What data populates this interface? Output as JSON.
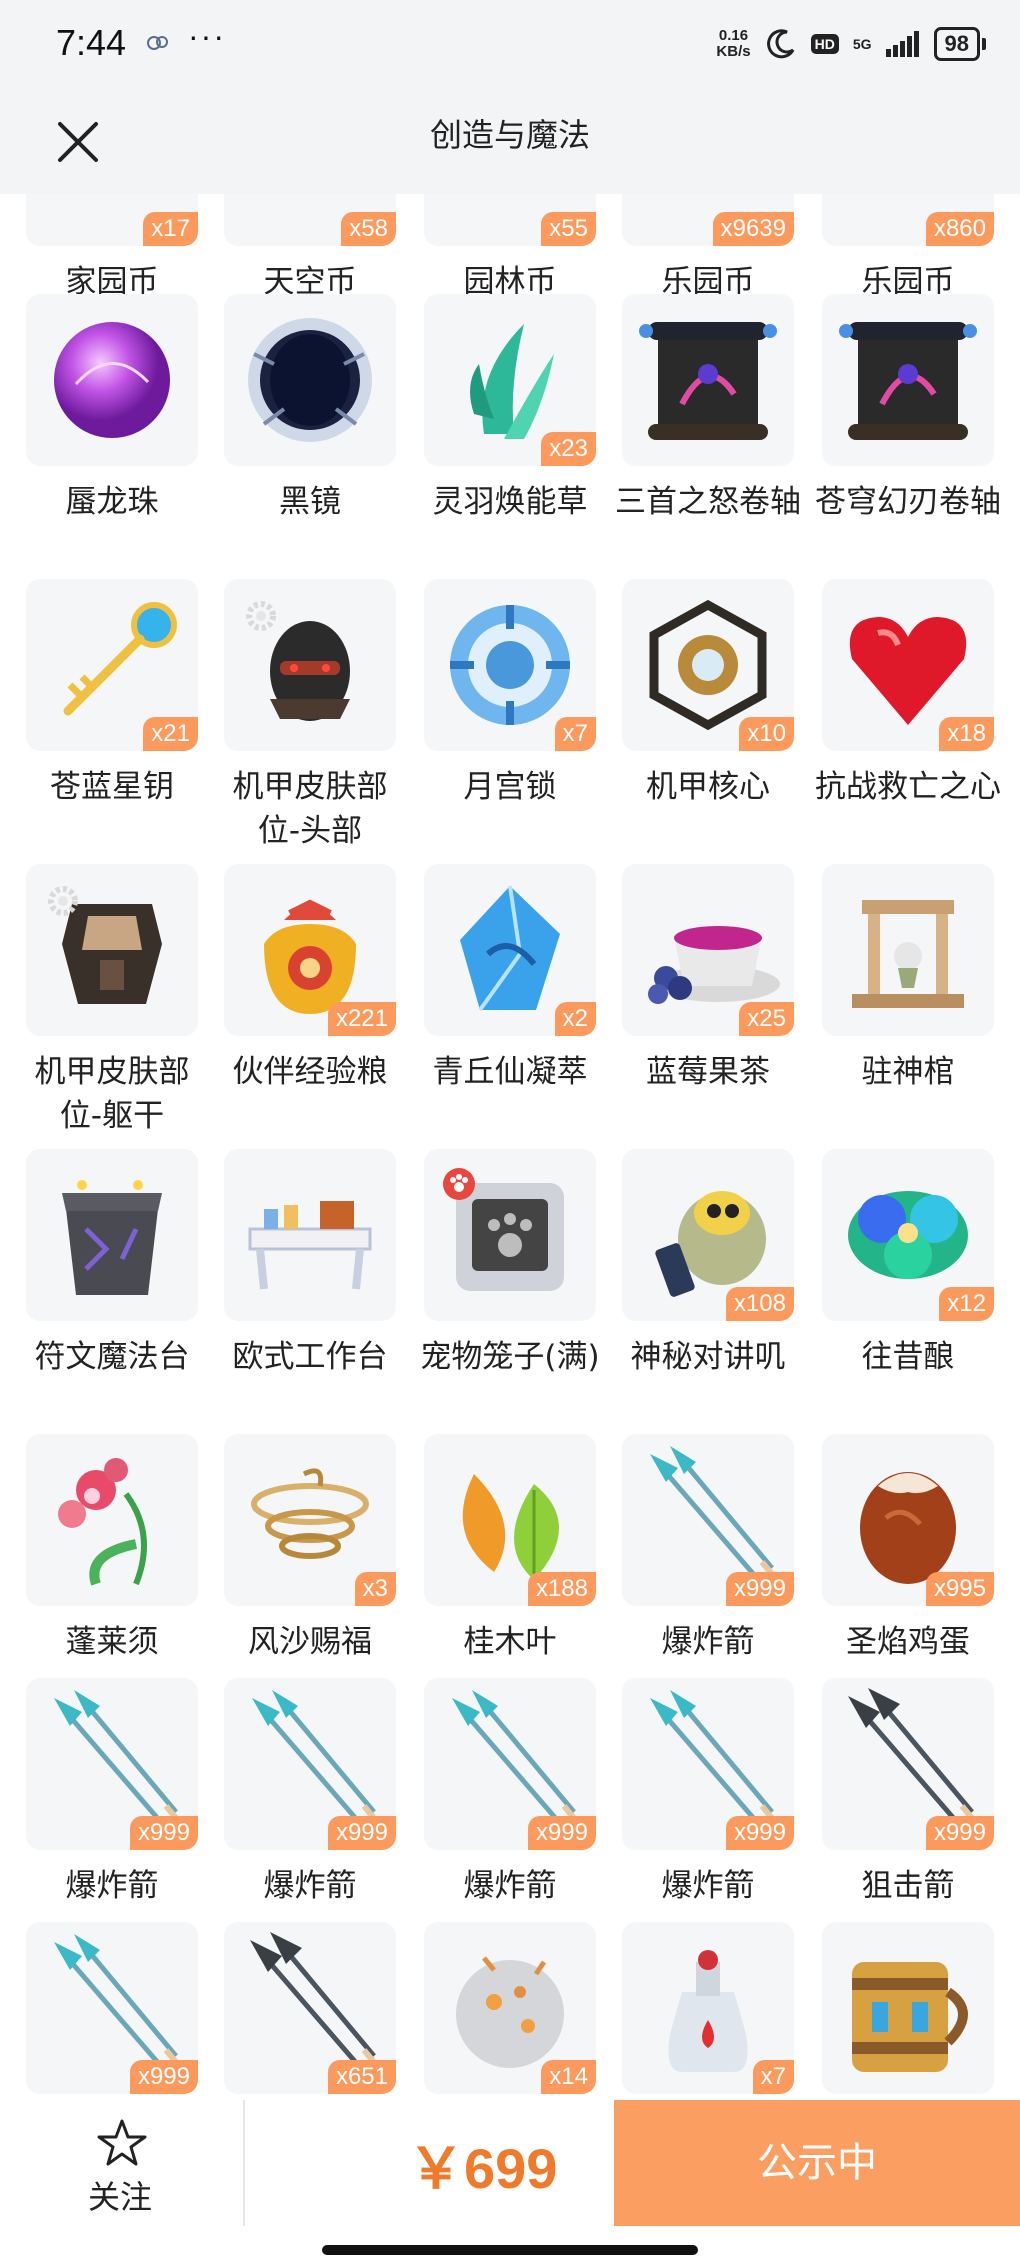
{
  "status_bar": {
    "time": "7:44",
    "dots": "···",
    "speed_value": "0.16",
    "speed_unit": "KB/s",
    "hd": "HD",
    "network": "5G",
    "battery": "98"
  },
  "header": {
    "title": "创造与魔法",
    "close_icon": "close-icon"
  },
  "items": [
    {
      "name": "家园币",
      "count": "x17",
      "icon": "coin-icon"
    },
    {
      "name": "天空币",
      "count": "x58",
      "icon": "coin-icon"
    },
    {
      "name": "园林币",
      "count": "x55",
      "icon": "coin-icon"
    },
    {
      "name": "乐园币",
      "count": "x9639",
      "icon": "coin-icon"
    },
    {
      "name": "乐园币",
      "count": "x860",
      "icon": "coin-icon"
    },
    {
      "name": "蜃龙珠",
      "count": "",
      "icon": "purple-orb-icon"
    },
    {
      "name": "黑镜",
      "count": "",
      "icon": "black-mirror-icon"
    },
    {
      "name": "灵羽焕能草",
      "count": "x23",
      "icon": "feather-grass-icon"
    },
    {
      "name": "三首之怒卷轴",
      "count": "",
      "icon": "scroll-icon"
    },
    {
      "name": "苍穹幻刃卷轴",
      "count": "",
      "icon": "scroll-icon"
    },
    {
      "name": "苍蓝星钥",
      "count": "x21",
      "icon": "key-icon"
    },
    {
      "name": "机甲皮肤部位-头部",
      "count": "",
      "icon": "mech-head-icon"
    },
    {
      "name": "月宫锁",
      "count": "x7",
      "icon": "moon-lock-icon"
    },
    {
      "name": "机甲核心",
      "count": "x10",
      "icon": "mech-core-icon"
    },
    {
      "name": "抗战救亡之心",
      "count": "x18",
      "icon": "heart-gem-icon"
    },
    {
      "name": "机甲皮肤部位-躯干",
      "count": "",
      "icon": "mech-torso-icon"
    },
    {
      "name": "伙伴经验粮",
      "count": "x221",
      "icon": "food-bag-icon"
    },
    {
      "name": "青丘仙凝萃",
      "count": "x2",
      "icon": "crystal-icon"
    },
    {
      "name": "蓝莓果茶",
      "count": "x25",
      "icon": "tea-cup-icon"
    },
    {
      "name": "驻神棺",
      "count": "",
      "icon": "shrine-icon"
    },
    {
      "name": "符文魔法台",
      "count": "",
      "icon": "rune-altar-icon"
    },
    {
      "name": "欧式工作台",
      "count": "",
      "icon": "workbench-icon"
    },
    {
      "name": "宠物笼子(满)",
      "count": "",
      "icon": "pet-cage-icon"
    },
    {
      "name": "神秘对讲叽",
      "count": "x108",
      "icon": "walkie-bird-icon"
    },
    {
      "name": "往昔酿",
      "count": "x12",
      "icon": "flower-brew-icon"
    },
    {
      "name": "蓬莱须",
      "count": "",
      "icon": "orchid-icon"
    },
    {
      "name": "风沙赐福",
      "count": "x3",
      "icon": "sand-swirl-icon"
    },
    {
      "name": "桂木叶",
      "count": "x188",
      "icon": "leaf-icon"
    },
    {
      "name": "爆炸箭",
      "count": "x999",
      "icon": "arrow-icon"
    },
    {
      "name": "圣焰鸡蛋",
      "count": "x995",
      "icon": "egg-icon"
    },
    {
      "name": "爆炸箭",
      "count": "x999",
      "icon": "arrow-icon"
    },
    {
      "name": "爆炸箭",
      "count": "x999",
      "icon": "arrow-icon"
    },
    {
      "name": "爆炸箭",
      "count": "x999",
      "icon": "arrow-icon"
    },
    {
      "name": "爆炸箭",
      "count": "x999",
      "icon": "arrow-icon"
    },
    {
      "name": "狙击箭",
      "count": "x999",
      "icon": "sniper-arrow-icon"
    },
    {
      "name": "",
      "count": "x999",
      "icon": "arrow-icon"
    },
    {
      "name": "",
      "count": "x651",
      "icon": "sniper-arrow-icon"
    },
    {
      "name": "",
      "count": "x14",
      "icon": "stone-ball-icon"
    },
    {
      "name": "",
      "count": "x7",
      "icon": "potion-icon"
    },
    {
      "name": "",
      "count": "",
      "icon": "barrel-mug-icon"
    }
  ],
  "bottom": {
    "follow_label": "关注",
    "price": "￥699",
    "status_button": "公示中"
  },
  "colors": {
    "accent": "#fb9e62",
    "price": "#f07a2c",
    "badge": "#fb9a5c"
  }
}
